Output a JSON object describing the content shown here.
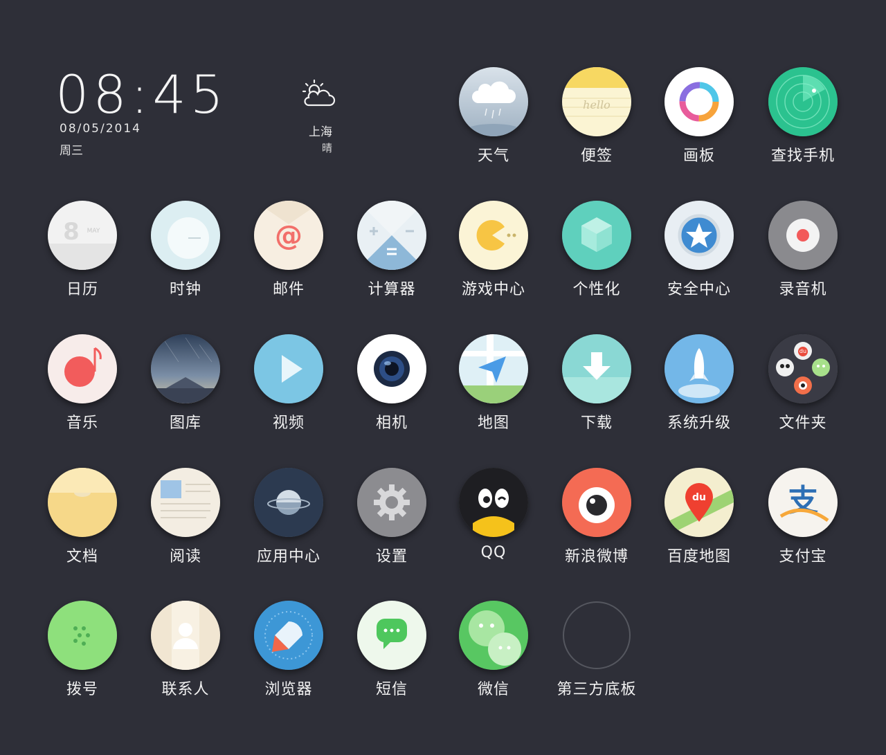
{
  "clock": {
    "time": "08:45",
    "date": "08/05/2014",
    "weekday": "周三"
  },
  "weather": {
    "icon": "partly-cloudy-icon",
    "city": "上海",
    "condition": "晴"
  },
  "apps": [
    {
      "id": "weather",
      "label": "天气",
      "icon": "weather-cloud-icon"
    },
    {
      "id": "notes",
      "label": "便签",
      "icon": "notepad-icon",
      "icon_text": "hello"
    },
    {
      "id": "paint",
      "label": "画板",
      "icon": "color-ring-icon"
    },
    {
      "id": "findphone",
      "label": "查找手机",
      "icon": "radar-icon"
    },
    {
      "id": "calendar",
      "label": "日历",
      "icon": "calendar-icon",
      "icon_text": "8",
      "icon_subtext": "MAY"
    },
    {
      "id": "clock",
      "label": "时钟",
      "icon": "clock-icon"
    },
    {
      "id": "mail",
      "label": "邮件",
      "icon": "at-sign-icon",
      "icon_text": "@"
    },
    {
      "id": "calculator",
      "label": "计算器",
      "icon": "calculator-icon"
    },
    {
      "id": "games",
      "label": "游戏中心",
      "icon": "pacman-icon"
    },
    {
      "id": "themes",
      "label": "个性化",
      "icon": "cube-icon"
    },
    {
      "id": "security",
      "label": "安全中心",
      "icon": "star-shield-icon"
    },
    {
      "id": "recorder",
      "label": "录音机",
      "icon": "record-icon"
    },
    {
      "id": "music",
      "label": "音乐",
      "icon": "music-note-icon"
    },
    {
      "id": "gallery",
      "label": "图库",
      "icon": "mountain-icon"
    },
    {
      "id": "video",
      "label": "视频",
      "icon": "play-icon"
    },
    {
      "id": "camera",
      "label": "相机",
      "icon": "camera-lens-icon"
    },
    {
      "id": "maps",
      "label": "地图",
      "icon": "map-arrow-icon"
    },
    {
      "id": "download",
      "label": "下载",
      "icon": "download-arrow-icon"
    },
    {
      "id": "update",
      "label": "系统升级",
      "icon": "rocket-icon"
    },
    {
      "id": "folder",
      "label": "文件夹",
      "icon": "folder-apps-icon",
      "icon_text": "du"
    },
    {
      "id": "docs",
      "label": "文档",
      "icon": "document-icon"
    },
    {
      "id": "reader",
      "label": "阅读",
      "icon": "book-icon"
    },
    {
      "id": "appstore",
      "label": "应用中心",
      "icon": "planet-icon"
    },
    {
      "id": "settings",
      "label": "设置",
      "icon": "gear-icon"
    },
    {
      "id": "qq",
      "label": "QQ",
      "icon": "penguin-icon"
    },
    {
      "id": "weibo",
      "label": "新浪微博",
      "icon": "eye-icon"
    },
    {
      "id": "baidumap",
      "label": "百度地图",
      "icon": "map-pin-icon",
      "icon_text": "du"
    },
    {
      "id": "alipay",
      "label": "支付宝",
      "icon": "alipay-icon",
      "icon_text": "支"
    },
    {
      "id": "dialer",
      "label": "拨号",
      "icon": "keypad-icon"
    },
    {
      "id": "contacts",
      "label": "联系人",
      "icon": "person-icon"
    },
    {
      "id": "browser",
      "label": "浏览器",
      "icon": "compass-icon"
    },
    {
      "id": "sms",
      "label": "短信",
      "icon": "chat-bubble-icon"
    },
    {
      "id": "wechat",
      "label": "微信",
      "icon": "wechat-icon"
    },
    {
      "id": "thirdparty",
      "label": "第三方底板",
      "icon": "empty-circle-icon"
    }
  ]
}
